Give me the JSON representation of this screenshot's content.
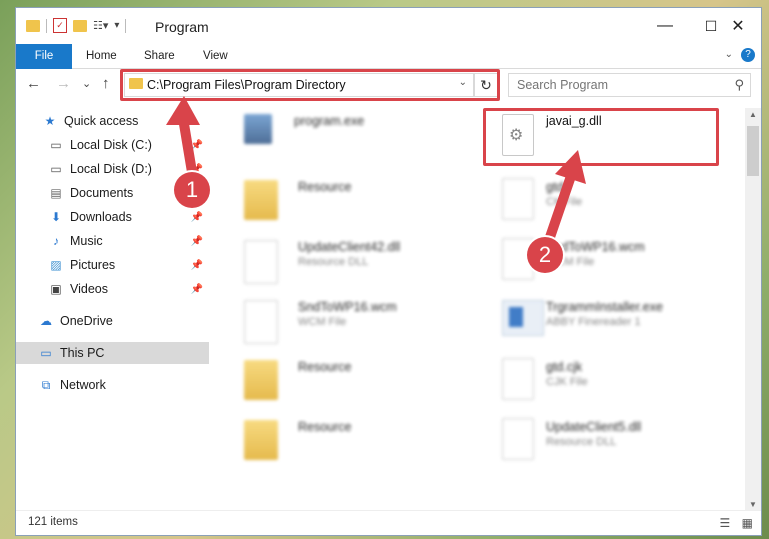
{
  "window": {
    "title": "Program",
    "controls": {
      "minimize": "—",
      "maximize": "☐",
      "close": "✕"
    }
  },
  "ribbon": {
    "tabs": [
      "File",
      "Home",
      "Share",
      "View"
    ],
    "help": "?"
  },
  "nav": {
    "back": "←",
    "forward": "→",
    "recent": "⌄",
    "up": "↑",
    "address": "C:\\Program Files\\Program Directory",
    "refresh": "↻",
    "search_placeholder": "Search Program",
    "search_icon": "search-icon"
  },
  "sidebar": {
    "items": [
      {
        "label": "Quick access",
        "icon": "star-icon"
      },
      {
        "label": "Local Disk (C:)",
        "icon": "drive-icon",
        "pinned": true
      },
      {
        "label": "Local Disk (D:)",
        "icon": "drive-icon",
        "pinned": true
      },
      {
        "label": "Documents",
        "icon": "documents-icon",
        "pinned": true
      },
      {
        "label": "Downloads",
        "icon": "download-icon",
        "pinned": true
      },
      {
        "label": "Music",
        "icon": "music-icon",
        "pinned": true
      },
      {
        "label": "Pictures",
        "icon": "pictures-icon",
        "pinned": true
      },
      {
        "label": "Videos",
        "icon": "videos-icon",
        "pinned": true
      },
      {
        "label": "OneDrive",
        "icon": "cloud-icon"
      },
      {
        "label": "This PC",
        "icon": "computer-icon",
        "selected": true
      },
      {
        "label": "Network",
        "icon": "network-icon"
      }
    ]
  },
  "files": [
    {
      "name": "program.exe",
      "type": "",
      "icon": "exe-icon"
    },
    {
      "name": "javai_g.dll",
      "type": "",
      "icon": "dll-gear-icon"
    },
    {
      "name": "Resource",
      "type": "",
      "icon": "folder-icon"
    },
    {
      "name": "gtd",
      "type": "CK File",
      "icon": "file-icon"
    },
    {
      "name": "UpdateClient42.dll",
      "type": "Resource DLL",
      "icon": "dll-gear-icon"
    },
    {
      "name": "SndToWP16.wcm",
      "type": "WCM File",
      "icon": "file-icon"
    },
    {
      "name": "SndToWP16.wcm",
      "type": "WCM File",
      "icon": "file-icon"
    },
    {
      "name": "TrgrammInstaller.exe",
      "type": "ABBY Finereader 1",
      "icon": "installer-icon"
    },
    {
      "name": "Resource",
      "type": "",
      "icon": "folder-icon"
    },
    {
      "name": "gtd.cjk",
      "type": "CJK File",
      "icon": "file-icon"
    },
    {
      "name": "Resource",
      "type": "",
      "icon": "folder-icon"
    },
    {
      "name": "UpdateClient5.dll",
      "type": "Resource DLL",
      "icon": "dll-gear-icon"
    }
  ],
  "status": {
    "count": "121 items",
    "view_details": "☰",
    "view_icons": "▦"
  },
  "annotations": {
    "step1": "1",
    "step2": "2",
    "color": "#d9444a"
  }
}
